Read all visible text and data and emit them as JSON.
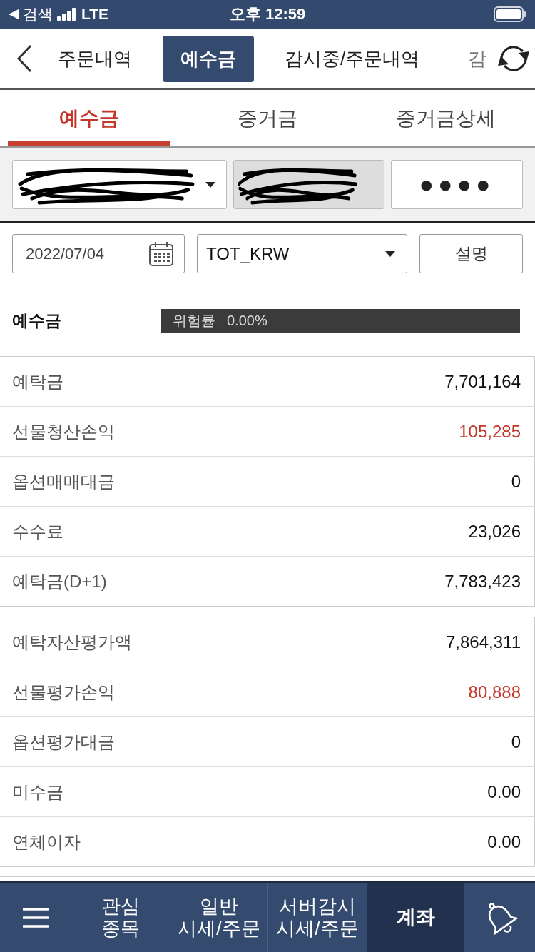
{
  "status_bar": {
    "back_app": "검색",
    "network": "LTE",
    "time": "오후 12:59"
  },
  "top_tabs": [
    {
      "label": "주문내역",
      "selected": false
    },
    {
      "label": "예수금",
      "selected": true
    },
    {
      "label": "감시중/주문내역",
      "selected": false
    },
    {
      "label": "감",
      "selected": false
    }
  ],
  "sub_tabs": [
    {
      "label": "예수금",
      "selected": true
    },
    {
      "label": "증거금",
      "selected": false
    },
    {
      "label": "증거금상세",
      "selected": false
    }
  ],
  "account_row": [
    {
      "kind": "select",
      "redacted": true
    },
    {
      "kind": "readonly",
      "redacted": true
    },
    {
      "kind": "password",
      "value": "●●●●"
    }
  ],
  "query_row": {
    "date": {
      "value": "2022/07/04"
    },
    "currency": {
      "value": "TOT_KRW"
    },
    "help_button": {
      "label": "설명"
    }
  },
  "summary": {
    "title": "예수금",
    "risk": {
      "label": "위험률",
      "value": "0.00%"
    }
  },
  "tables": [
    [
      {
        "label": "예탁금",
        "value": "7,701,164",
        "color": "#111111"
      },
      {
        "label": "선물청산손익",
        "value": "105,285",
        "color": "#c5362a"
      },
      {
        "label": "옵션매매대금",
        "value": "0",
        "color": "#111111"
      },
      {
        "label": "수수료",
        "value": "23,026",
        "color": "#111111"
      },
      {
        "label": "예탁금(D+1)",
        "value": "7,783,423",
        "color": "#111111"
      }
    ],
    [
      {
        "label": "예탁자산평가액",
        "value": "7,864,311",
        "color": "#111111"
      },
      {
        "label": "선물평가손익",
        "value": "80,888",
        "color": "#c5362a"
      },
      {
        "label": "옵션평가대금",
        "value": "0",
        "color": "#111111"
      },
      {
        "label": "미수금",
        "value": "0.00",
        "color": "#111111"
      },
      {
        "label": "연체이자",
        "value": "0.00",
        "color": "#111111"
      }
    ]
  ],
  "bottom_nav": [
    {
      "kind": "menu",
      "selected": false
    },
    {
      "kind": "text",
      "label": "관심\n종목",
      "selected": false
    },
    {
      "kind": "text",
      "label": "일반\n시세/주문",
      "selected": false
    },
    {
      "kind": "text",
      "label": "서버감시\n시세/주문",
      "selected": false
    },
    {
      "kind": "text",
      "label": "계좌",
      "selected": true
    },
    {
      "kind": "bell",
      "selected": false
    }
  ]
}
